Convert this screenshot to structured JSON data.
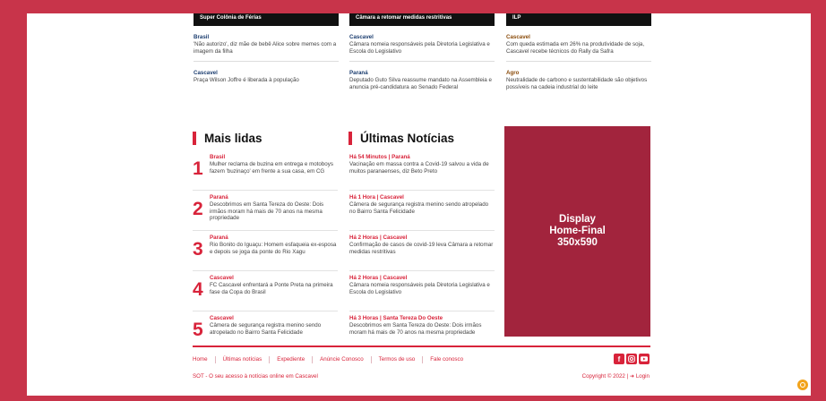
{
  "top": {
    "col1": {
      "banner": "Super Colônia de Férias",
      "items": [
        {
          "cat": "Brasil",
          "text": "'Não autorizo', diz mãe de bebê Alice sobre memes com a imagem da filha"
        },
        {
          "cat": "Cascavel",
          "text": "Praça Wilson Joffre é liberada à população"
        }
      ]
    },
    "col2": {
      "banner": "Câmara a retomar medidas restritivas",
      "items": [
        {
          "cat": "Cascavel",
          "text": "Câmara nomeia responsáveis pela Diretoria Legislativa e Escola do Legislativo"
        },
        {
          "cat": "Paraná",
          "text": "Deputado Guto Silva reassume mandato na Assembleia e anuncia pré-candidatura ao Senado Federal"
        }
      ]
    },
    "col3": {
      "banner": "ILP",
      "items": [
        {
          "cat": "Cascavel",
          "text": "Com queda estimada em 26% na produtividade de soja, Cascavel recebe técnicos do Rally da Safra"
        },
        {
          "cat": "Agro",
          "text": "Neutralidade de carbono e sustentabilidade são objetivos possíveis na cadeia industrial do leite"
        }
      ]
    }
  },
  "mais_lidas": {
    "title": "Mais lidas",
    "items": [
      {
        "num": "1",
        "cat": "Brasil",
        "text": "Mulher reclama de buzina em entrega e motoboys fazem 'buzinaço' em frente a sua casa, em CG"
      },
      {
        "num": "2",
        "cat": "Paraná",
        "text": "Descobrimos em Santa Tereza do Oeste: Dois irmãos moram há mais de 70 anos na mesma propriedade"
      },
      {
        "num": "3",
        "cat": "Paraná",
        "text": "Rio Bonito do Iguaçu: Homem esfaqueia ex-esposa e depois se joga da ponte do Rio Xagu"
      },
      {
        "num": "4",
        "cat": "Cascavel",
        "text": "FC Cascavel enfrentará a Ponte Preta na primeira fase da Copa do Brasil"
      },
      {
        "num": "5",
        "cat": "Cascavel",
        "text": "Câmera de segurança registra menino sendo atropelado no Bairro Santa Felicidade"
      }
    ]
  },
  "ultimas": {
    "title": "Últimas Notícias",
    "items": [
      {
        "time": "Há 54 Minutos | Paraná",
        "text": "Vacinação em massa contra a Covid-19 salvou a vida de muitos paranaenses, diz Beto Preto"
      },
      {
        "time": "Há 1 Hora | Cascavel",
        "text": "Câmera de segurança registra menino sendo atropelado no Bairro Santa Felicidade"
      },
      {
        "time": "Há 2 Horas | Cascavel",
        "text": "Confirmação de casos de covid-19 leva Câmara a retomar medidas restritivas"
      },
      {
        "time": "Há 2 Horas | Cascavel",
        "text": "Câmara nomeia responsáveis pela Diretoria Legislativa e Escola do Legislativo"
      },
      {
        "time": "Há 3 Horas | Santa Tereza Do Oeste",
        "text": "Descobrimos em Santa Tereza do Oeste: Dois irmãos moram há mais de 70 anos na mesma propriedade"
      }
    ]
  },
  "ad": {
    "text": "Display\nHome-Final\n350x590"
  },
  "footer": {
    "links": [
      "Home",
      "Últimas notícias",
      "Expediente",
      "Anúncie Conosco",
      "Termos de uso",
      "Fale conosco"
    ],
    "tagline": "SOT - O seu acesso à notícias online em Cascavel",
    "copyright": "Copyright © 2022 |",
    "login": "Login",
    "socials": [
      "facebook-icon",
      "instagram-icon",
      "youtube-icon"
    ]
  },
  "colors": {
    "accent": "#d8233a",
    "background": "#c8344a",
    "ad": "#a2243d"
  }
}
